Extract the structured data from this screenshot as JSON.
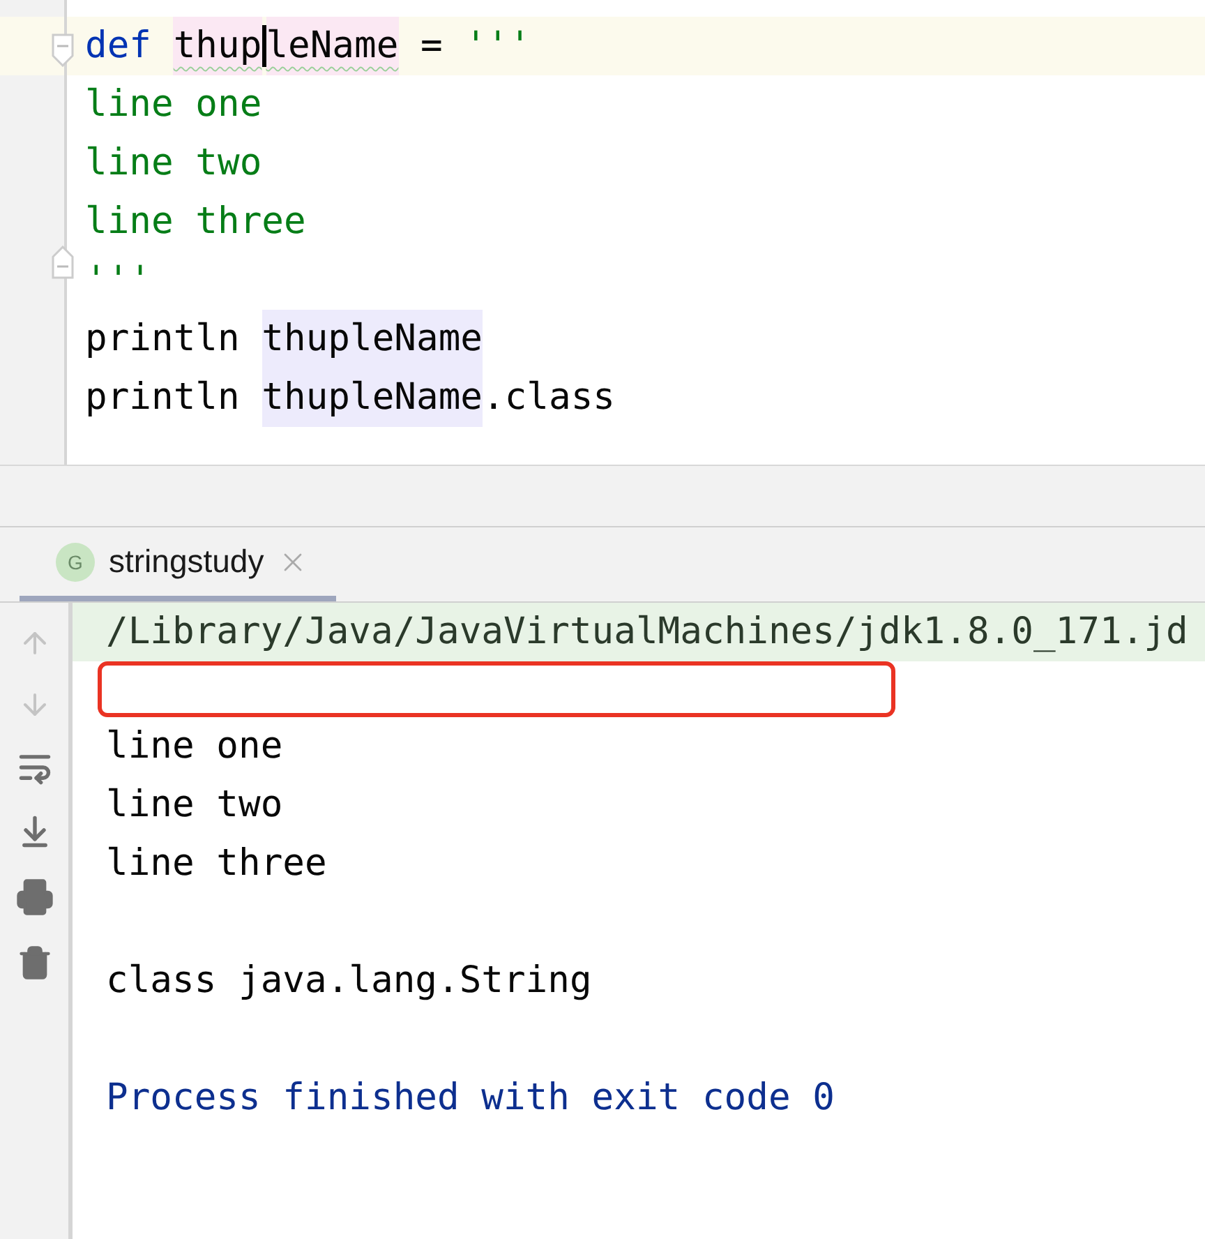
{
  "editor": {
    "lines": [
      {
        "current": true,
        "fold_start": true,
        "tokens": [
          {
            "text": "def ",
            "kind": "keyword"
          },
          {
            "text": "thup",
            "kind": "declared",
            "typo": true,
            "caret": true
          },
          {
            "text": "leName",
            "kind": "declared",
            "typo": true
          },
          {
            "text": " = ",
            "kind": "plain"
          },
          {
            "text": "'''",
            "kind": "string"
          }
        ]
      },
      {
        "current": false,
        "tokens": [
          {
            "text": "line one",
            "kind": "string"
          }
        ]
      },
      {
        "current": false,
        "tokens": [
          {
            "text": "line two",
            "kind": "string"
          }
        ]
      },
      {
        "current": false,
        "tokens": [
          {
            "text": "line three",
            "kind": "string"
          }
        ]
      },
      {
        "current": false,
        "fold_end": true,
        "tokens": [
          {
            "text": "'''",
            "kind": "string"
          }
        ]
      },
      {
        "current": false,
        "tokens": [
          {
            "text": "println ",
            "kind": "plain"
          },
          {
            "text": "thupleName",
            "kind": "usage"
          }
        ]
      },
      {
        "current": false,
        "tokens": [
          {
            "text": "println ",
            "kind": "plain"
          },
          {
            "text": "thupleName",
            "kind": "usage"
          },
          {
            "text": ".class",
            "kind": "plain"
          }
        ]
      }
    ]
  },
  "run_tab": {
    "icon_letter": "G",
    "label": "stringstudy",
    "selected": true
  },
  "console": {
    "lines": [
      {
        "kind": "command",
        "text": "/Library/Java/JavaVirtualMachines/jdk1.8.0_171.jd"
      },
      {
        "kind": "marked"
      },
      {
        "kind": "output",
        "text": "line one"
      },
      {
        "kind": "output",
        "text": "line two"
      },
      {
        "kind": "output",
        "text": "line three"
      },
      {
        "kind": "blank"
      },
      {
        "kind": "output",
        "text": "class java.lang.String"
      },
      {
        "kind": "blank"
      },
      {
        "kind": "exit",
        "text": "Process finished with exit code 0"
      }
    ]
  }
}
